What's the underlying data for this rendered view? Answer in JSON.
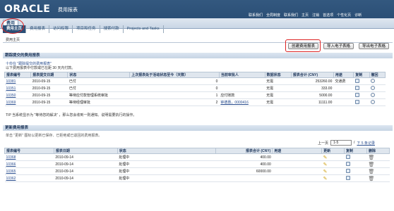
{
  "header": {
    "logo": "ORACLE",
    "app_title": "费用报表",
    "global_links": [
      "联系我们",
      "全局制度",
      "联系我们",
      "主页",
      "注销",
      "首选项",
      "个性化页",
      "诊断"
    ]
  },
  "tabs": {
    "main": "费用",
    "sub": [
      "费用主页",
      "费用报表",
      "访问权限",
      "项目和任务",
      "搜索付款",
      "Projects and Tasks"
    ]
  },
  "breadcrumb": "费用主页",
  "toolbar": {
    "create": "创建费用报表",
    "import": "导入电子表格",
    "export": "导出电子表格"
  },
  "section1": {
    "title": "跟踪提交的费用报表",
    "tip1": "十份在 \"跟踪提交的费用报表\"",
    "tip2": "以下费用报表中付款或已在距 30 天内付款。",
    "headers": [
      "报表编号",
      "报表提交日期",
      "状态",
      "上次报表处于活动状态至今（天数）",
      "当前审批人",
      "数据状态",
      "报表合计 (CNY)",
      "用途",
      "复制",
      "撤回"
    ],
    "rows": [
      [
        "10381",
        "2010-09-15",
        "已付",
        "0",
        "",
        "无需",
        "253260.00",
        "交通费"
      ],
      [
        "10351",
        "2010-09-15",
        "已付",
        "0",
        "",
        "无需",
        "333.00",
        ""
      ],
      [
        "10350",
        "2010-09-15",
        "等待应付款管理系统审批",
        "1",
        "应付账款",
        "无需",
        "5000.00",
        ""
      ],
      [
        "10369",
        "2010-09-15",
        "等待经理审批",
        "2",
        "钟德惠，0000416",
        "无需",
        "11111.00",
        ""
      ]
    ],
    "note": "TIP 当系统显示为 \"等待您的解决\" ，那么您会收到一则通知。说明需要执行的操作。"
  },
  "section2": {
    "title": "更新费用报表",
    "tip": "单击 \"更新\" 图标以更新已保存、已拒绝或已退回的费用报表。",
    "pager": {
      "prev": "上一页",
      "range": "1-5",
      "of": "/",
      "next": "下 5 条记录"
    },
    "headers": [
      "报表编号",
      "报表日期",
      "状态",
      "报表合计 (CNY)",
      "用途",
      "更新",
      "复制",
      "删除"
    ],
    "rows": [
      [
        "10368",
        "2010-09-14",
        "处理中",
        "400.00"
      ],
      [
        "10366",
        "2010-09-14",
        "处理中",
        "400.00"
      ],
      [
        "10365",
        "2010-09-14",
        "处理中",
        "60000.00"
      ],
      [
        "10362",
        "2010-09-14",
        "处理中",
        ""
      ]
    ]
  }
}
